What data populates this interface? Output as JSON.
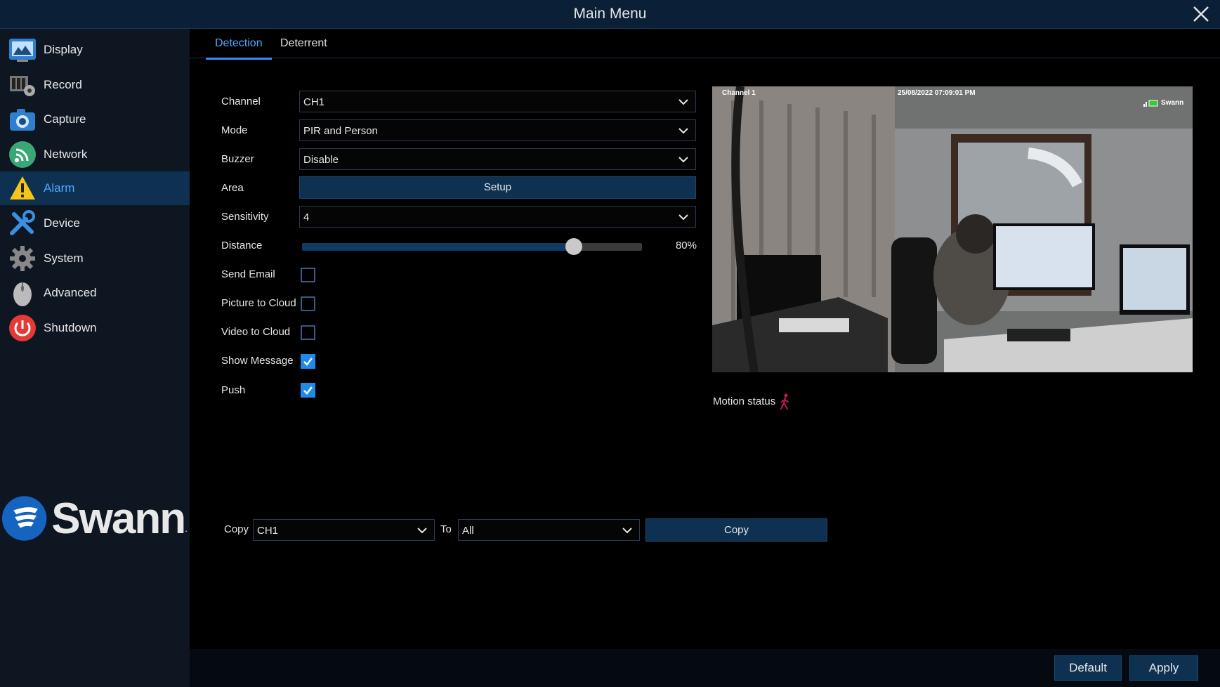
{
  "window": {
    "title": "Main Menu"
  },
  "sidebar": {
    "items": [
      {
        "label": "Display",
        "icon": "display-icon"
      },
      {
        "label": "Record",
        "icon": "record-icon"
      },
      {
        "label": "Capture",
        "icon": "camera-icon"
      },
      {
        "label": "Network",
        "icon": "network-icon"
      },
      {
        "label": "Alarm",
        "icon": "alarm-icon",
        "active": true
      },
      {
        "label": "Device",
        "icon": "device-icon"
      },
      {
        "label": "System",
        "icon": "gear-icon"
      },
      {
        "label": "Advanced",
        "icon": "mouse-icon"
      },
      {
        "label": "Shutdown",
        "icon": "power-icon"
      }
    ],
    "brand": "Swann",
    "brand_mark": "."
  },
  "tabs": [
    {
      "label": "Detection",
      "active": true
    },
    {
      "label": "Deterrent",
      "active": false
    }
  ],
  "form": {
    "channel": {
      "label": "Channel",
      "value": "CH1"
    },
    "mode": {
      "label": "Mode",
      "value": "PIR and Person"
    },
    "buzzer": {
      "label": "Buzzer",
      "value": "Disable"
    },
    "area": {
      "label": "Area",
      "button": "Setup"
    },
    "sensitivity": {
      "label": "Sensitivity",
      "value": "4"
    },
    "distance": {
      "label": "Distance",
      "value_text": "80%",
      "fraction": 0.8
    },
    "send_email": {
      "label": "Send Email",
      "checked": false
    },
    "picture_to_cloud": {
      "label": "Picture to Cloud",
      "checked": false
    },
    "video_to_cloud": {
      "label": "Video to Cloud",
      "checked": false
    },
    "show_message": {
      "label": "Show Message",
      "checked": true
    },
    "push": {
      "label": "Push",
      "checked": true
    }
  },
  "preview": {
    "channel_osd": "Channel 1",
    "timestamp_osd": "25/08/2022 07:09:01 PM",
    "brand_osd": "Swann"
  },
  "motion_status": {
    "label": "Motion status",
    "icon": "person-walking-icon",
    "color": "#c2185b"
  },
  "copy": {
    "label": "Copy",
    "from_value": "CH1",
    "to_label": "To",
    "to_value": "All",
    "button": "Copy"
  },
  "footer": {
    "default_button": "Default",
    "apply_button": "Apply"
  },
  "colors": {
    "accent": "#2f8fff",
    "panel": "#0e3152",
    "sidebar": "#0e1622",
    "titlebar": "#0b2036"
  }
}
